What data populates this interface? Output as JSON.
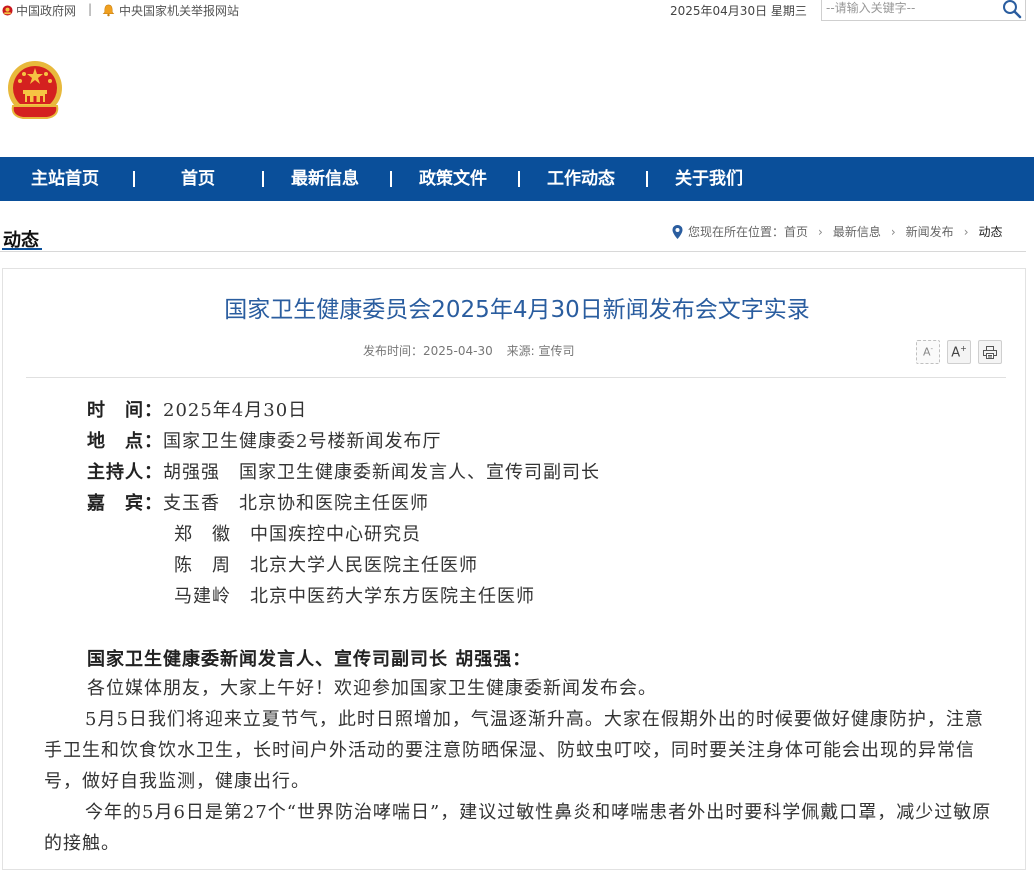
{
  "topbar": {
    "gov_link": "中国政府网",
    "separator": "|",
    "report_link": "中央国家机关举报网站",
    "date": "2025年04月30日 星期三",
    "search_placeholder": "--请输入关键字--",
    "icons": [
      "emblem-icon",
      "bell-icon",
      "search-icon"
    ]
  },
  "nav": {
    "items": [
      "主站首页",
      "首页",
      "最新信息",
      "政策文件",
      "工作动态",
      "关于我们"
    ]
  },
  "section": {
    "title": "动态",
    "breadcrumb": {
      "prefix": "您现在所在位置：",
      "crumbs": [
        "首页",
        "最新信息",
        "新闻发布",
        "动态"
      ]
    }
  },
  "article": {
    "title": "国家卫生健康委员会2025年4月30日新闻发布会文字实录",
    "publish_label": "发布时间：",
    "publish_date": "2025-04-30",
    "source_label": "来源: 宣传司",
    "tools": [
      "A-",
      "A+",
      "print"
    ],
    "info": {
      "time_label": "时　间：",
      "time_value": "2025年4月30日",
      "place_label": "地　点：",
      "place_value": "国家卫生健康委2号楼新闻发布厅",
      "host_label": "主持人：",
      "host_value": "胡强强　国家卫生健康委新闻发言人、宣传司副司长",
      "guests_label": "嘉　宾：",
      "guests": [
        "支玉香　北京协和医院主任医师",
        "郑　徽　中国疾控中心研究员",
        "陈　周　北京大学人民医院主任医师",
        "马建岭　北京中医药大学东方医院主任医师"
      ]
    },
    "speaker": "国家卫生健康委新闻发言人、宣传司副司长 胡强强：",
    "paragraphs": [
      "各位媒体朋友，大家上午好！欢迎参加国家卫生健康委新闻发布会。",
      "5月5日我们将迎来立夏节气，此时日照增加，气温逐渐升高。大家在假期外出的时候要做好健康防护，注意手卫生和饮食饮水卫生，长时间户外活动的要注意防晒保湿、防蚊虫叮咬，同时要关注身体可能会出现的异常信号，做好自我监测，健康出行。",
      "今年的5月6日是第27个“世界防治哮喘日”，建议过敏性鼻炎和哮喘患者外出时要科学佩戴口罩，减少过敏原的接触。"
    ]
  },
  "colors": {
    "nav_bg": "#0a4f9a",
    "title": "#2a5d9f"
  }
}
